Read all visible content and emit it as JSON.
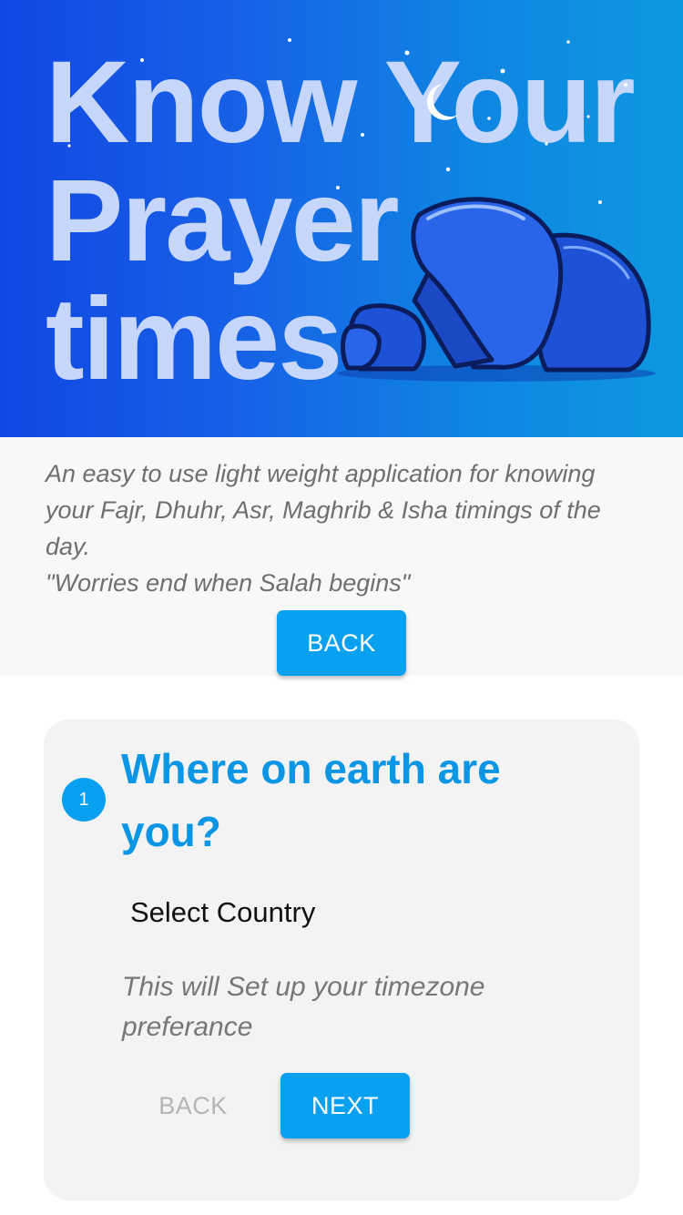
{
  "hero": {
    "title": "Know Your\nPrayer\ntimes"
  },
  "intro": {
    "description": "An easy to use light weight application for knowing your Fajr, Dhuhr, Asr, Maghrib & Isha timings of the day.",
    "quote": "\"Worries end when Salah begins\"",
    "back_label": "BACK"
  },
  "setup_step": {
    "step_number": "1",
    "title": "Where on earth are you?",
    "select_placeholder": "Select Country",
    "hint": "This will Set up your timezone preferance",
    "back_label": "BACK",
    "next_label": "NEXT"
  },
  "colors": {
    "accent": "#0aa0f0",
    "title_blue": "#0a96e4",
    "hero_start": "#1147e3",
    "hero_end": "#0d99e0"
  },
  "icons": [
    "crescent-moon-icon",
    "praying-person-illustration",
    "star-icon"
  ]
}
